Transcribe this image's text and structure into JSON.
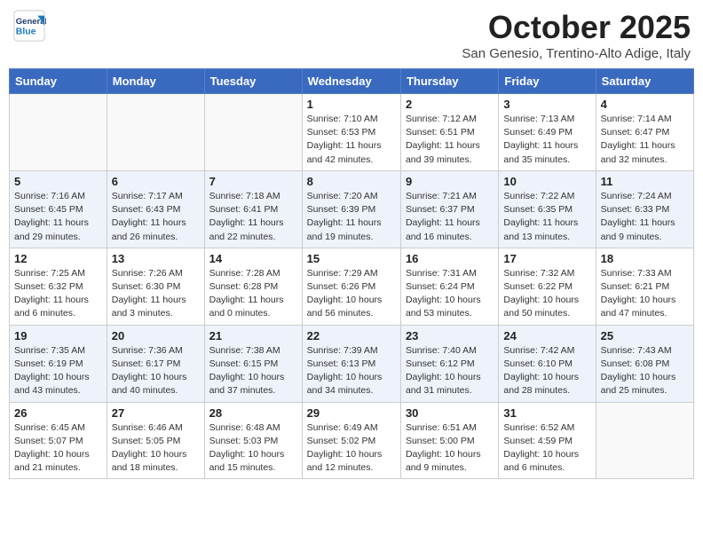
{
  "header": {
    "logo_general": "General",
    "logo_blue": "Blue",
    "month": "October 2025",
    "location": "San Genesio, Trentino-Alto Adige, Italy"
  },
  "weekdays": [
    "Sunday",
    "Monday",
    "Tuesday",
    "Wednesday",
    "Thursday",
    "Friday",
    "Saturday"
  ],
  "weeks": [
    [
      {
        "day": "",
        "info": ""
      },
      {
        "day": "",
        "info": ""
      },
      {
        "day": "",
        "info": ""
      },
      {
        "day": "1",
        "info": "Sunrise: 7:10 AM\nSunset: 6:53 PM\nDaylight: 11 hours and 42 minutes."
      },
      {
        "day": "2",
        "info": "Sunrise: 7:12 AM\nSunset: 6:51 PM\nDaylight: 11 hours and 39 minutes."
      },
      {
        "day": "3",
        "info": "Sunrise: 7:13 AM\nSunset: 6:49 PM\nDaylight: 11 hours and 35 minutes."
      },
      {
        "day": "4",
        "info": "Sunrise: 7:14 AM\nSunset: 6:47 PM\nDaylight: 11 hours and 32 minutes."
      }
    ],
    [
      {
        "day": "5",
        "info": "Sunrise: 7:16 AM\nSunset: 6:45 PM\nDaylight: 11 hours and 29 minutes."
      },
      {
        "day": "6",
        "info": "Sunrise: 7:17 AM\nSunset: 6:43 PM\nDaylight: 11 hours and 26 minutes."
      },
      {
        "day": "7",
        "info": "Sunrise: 7:18 AM\nSunset: 6:41 PM\nDaylight: 11 hours and 22 minutes."
      },
      {
        "day": "8",
        "info": "Sunrise: 7:20 AM\nSunset: 6:39 PM\nDaylight: 11 hours and 19 minutes."
      },
      {
        "day": "9",
        "info": "Sunrise: 7:21 AM\nSunset: 6:37 PM\nDaylight: 11 hours and 16 minutes."
      },
      {
        "day": "10",
        "info": "Sunrise: 7:22 AM\nSunset: 6:35 PM\nDaylight: 11 hours and 13 minutes."
      },
      {
        "day": "11",
        "info": "Sunrise: 7:24 AM\nSunset: 6:33 PM\nDaylight: 11 hours and 9 minutes."
      }
    ],
    [
      {
        "day": "12",
        "info": "Sunrise: 7:25 AM\nSunset: 6:32 PM\nDaylight: 11 hours and 6 minutes."
      },
      {
        "day": "13",
        "info": "Sunrise: 7:26 AM\nSunset: 6:30 PM\nDaylight: 11 hours and 3 minutes."
      },
      {
        "day": "14",
        "info": "Sunrise: 7:28 AM\nSunset: 6:28 PM\nDaylight: 11 hours and 0 minutes."
      },
      {
        "day": "15",
        "info": "Sunrise: 7:29 AM\nSunset: 6:26 PM\nDaylight: 10 hours and 56 minutes."
      },
      {
        "day": "16",
        "info": "Sunrise: 7:31 AM\nSunset: 6:24 PM\nDaylight: 10 hours and 53 minutes."
      },
      {
        "day": "17",
        "info": "Sunrise: 7:32 AM\nSunset: 6:22 PM\nDaylight: 10 hours and 50 minutes."
      },
      {
        "day": "18",
        "info": "Sunrise: 7:33 AM\nSunset: 6:21 PM\nDaylight: 10 hours and 47 minutes."
      }
    ],
    [
      {
        "day": "19",
        "info": "Sunrise: 7:35 AM\nSunset: 6:19 PM\nDaylight: 10 hours and 43 minutes."
      },
      {
        "day": "20",
        "info": "Sunrise: 7:36 AM\nSunset: 6:17 PM\nDaylight: 10 hours and 40 minutes."
      },
      {
        "day": "21",
        "info": "Sunrise: 7:38 AM\nSunset: 6:15 PM\nDaylight: 10 hours and 37 minutes."
      },
      {
        "day": "22",
        "info": "Sunrise: 7:39 AM\nSunset: 6:13 PM\nDaylight: 10 hours and 34 minutes."
      },
      {
        "day": "23",
        "info": "Sunrise: 7:40 AM\nSunset: 6:12 PM\nDaylight: 10 hours and 31 minutes."
      },
      {
        "day": "24",
        "info": "Sunrise: 7:42 AM\nSunset: 6:10 PM\nDaylight: 10 hours and 28 minutes."
      },
      {
        "day": "25",
        "info": "Sunrise: 7:43 AM\nSunset: 6:08 PM\nDaylight: 10 hours and 25 minutes."
      }
    ],
    [
      {
        "day": "26",
        "info": "Sunrise: 6:45 AM\nSunset: 5:07 PM\nDaylight: 10 hours and 21 minutes."
      },
      {
        "day": "27",
        "info": "Sunrise: 6:46 AM\nSunset: 5:05 PM\nDaylight: 10 hours and 18 minutes."
      },
      {
        "day": "28",
        "info": "Sunrise: 6:48 AM\nSunset: 5:03 PM\nDaylight: 10 hours and 15 minutes."
      },
      {
        "day": "29",
        "info": "Sunrise: 6:49 AM\nSunset: 5:02 PM\nDaylight: 10 hours and 12 minutes."
      },
      {
        "day": "30",
        "info": "Sunrise: 6:51 AM\nSunset: 5:00 PM\nDaylight: 10 hours and 9 minutes."
      },
      {
        "day": "31",
        "info": "Sunrise: 6:52 AM\nSunset: 4:59 PM\nDaylight: 10 hours and 6 minutes."
      },
      {
        "day": "",
        "info": ""
      }
    ]
  ]
}
